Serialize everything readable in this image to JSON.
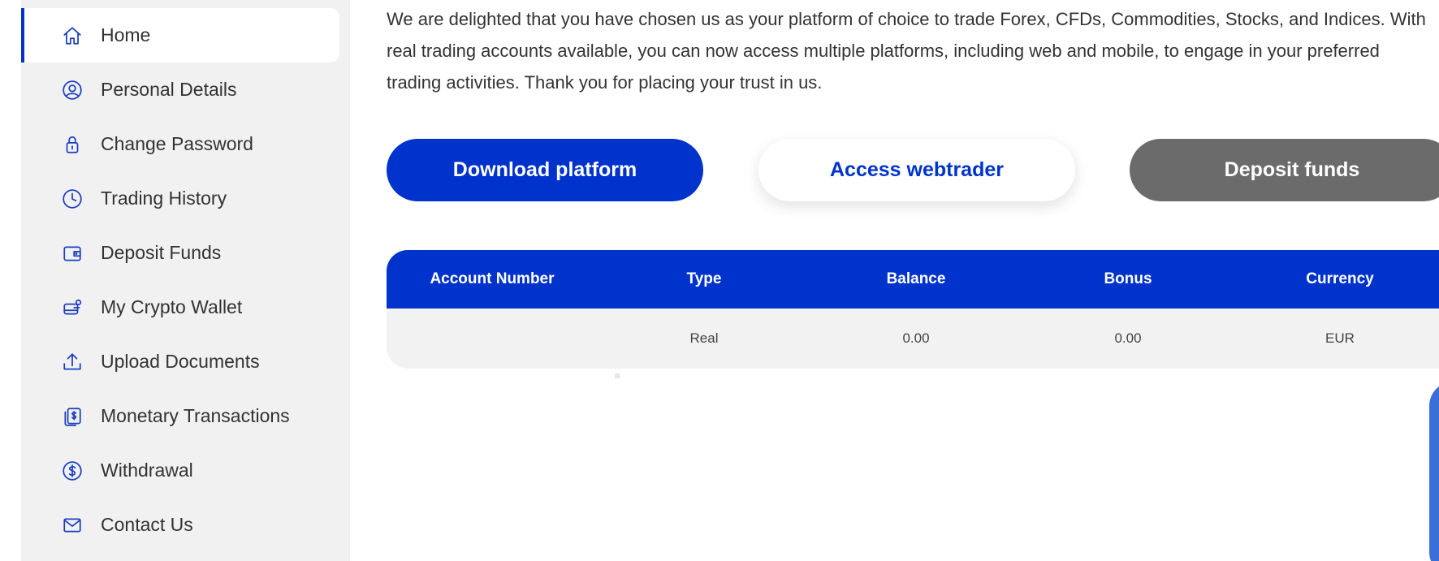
{
  "sidebar": {
    "items": [
      {
        "label": "Home",
        "icon": "home-icon",
        "active": true
      },
      {
        "label": "Personal Details",
        "icon": "user-circle-icon"
      },
      {
        "label": "Change Password",
        "icon": "lock-icon"
      },
      {
        "label": "Trading History",
        "icon": "clock-icon"
      },
      {
        "label": "Deposit Funds",
        "icon": "wallet-icon"
      },
      {
        "label": "My Crypto Wallet",
        "icon": "crypto-wallet-icon"
      },
      {
        "label": "Upload Documents",
        "icon": "upload-icon"
      },
      {
        "label": "Monetary Transactions",
        "icon": "money-transfer-icon"
      },
      {
        "label": "Withdrawal",
        "icon": "dollar-circle-icon"
      },
      {
        "label": "Contact Us",
        "icon": "envelope-icon"
      }
    ]
  },
  "main": {
    "intro_text": "We are delighted that you have chosen us as your platform of choice to trade Forex, CFDs, Commodities, Stocks, and Indices. With real trading accounts available, you can now access multiple platforms, including web and mobile, to engage in your preferred trading activities. Thank you for placing your trust in us.",
    "buttons": {
      "download": "Download platform",
      "webtrader": "Access webtrader",
      "deposit": "Deposit funds"
    },
    "accounts_table": {
      "headers": [
        "Account Number",
        "Type",
        "Balance",
        "Bonus",
        "Currency"
      ],
      "rows": [
        [
          "",
          "Real",
          "0.00",
          "0.00",
          "EUR"
        ]
      ]
    }
  },
  "colors": {
    "accent": "#0033cc",
    "sidebar_bg": "#f1f1f1",
    "deposit_button": "#6b6b6b"
  }
}
